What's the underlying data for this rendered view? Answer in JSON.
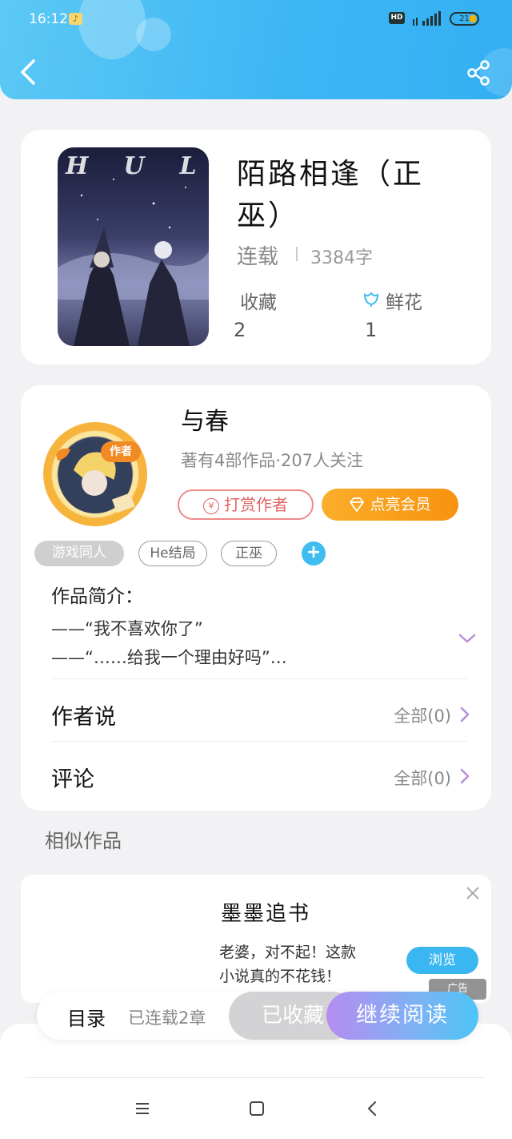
{
  "status_bar": {
    "time": "16:12",
    "hd": "HD",
    "battery": "21"
  },
  "book": {
    "title": "陌路相逢（正巫）",
    "title_line1": "陌路相逢（正",
    "title_line2": "巫）",
    "cover_text": "HUL",
    "status": "连载",
    "words": "3384字",
    "collect_label": "收藏",
    "collect_count": "2",
    "flower_label": "鲜花",
    "flower_count": "1"
  },
  "author": {
    "badge": "作者",
    "name": "与春",
    "meta": "著有4部作品·207人关注",
    "tip_button": "打赏作者",
    "tip_icon_text": "¥",
    "vip_button": "点亮会员",
    "tags": [
      "游戏同人",
      "He结局",
      "正巫"
    ],
    "add_tag": "+",
    "intro_label": "作品简介：",
    "intro_lines": [
      "——“我不喜欢你了”",
      "——“……给我一个理由好吗”…"
    ],
    "author_says_label": "作者说",
    "author_says_link": "全部(0)",
    "comments_label": "评论",
    "comments_link": "全部(0)"
  },
  "similar": {
    "title": "相似作品",
    "ad_title": "墨墨追书",
    "ad_line1": "老婆，对不起！这款",
    "ad_line2": "小说真的不花钱！",
    "ad_button": "浏览",
    "ad_badge": "广告"
  },
  "bottom_bar": {
    "toc": "目录",
    "chapters": "已连载2章",
    "collected": "已收藏",
    "continue": "继续阅读"
  },
  "colors": {
    "header": "#3fb6f4",
    "accent": "#3ab7f0",
    "vip": "#f7920f",
    "tip": "#e06464"
  }
}
